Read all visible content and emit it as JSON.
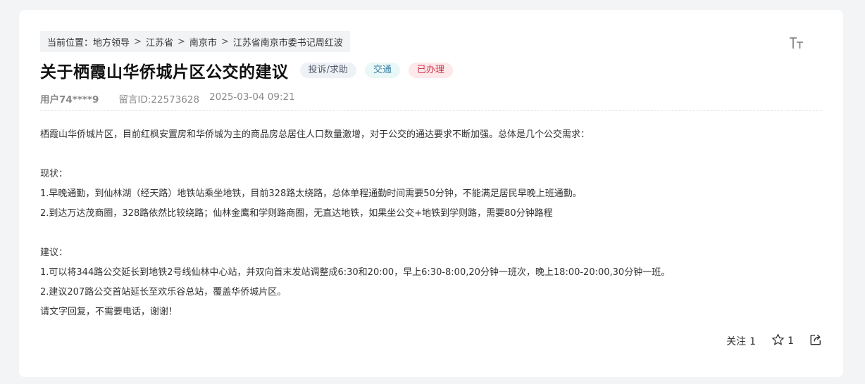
{
  "breadcrumb": {
    "prefix": "当前位置：",
    "items": [
      "地方领导",
      "江苏省",
      "南京市",
      "江苏省南京市委书记周红波"
    ],
    "separator": ">"
  },
  "post": {
    "title": "关于栖霞山华侨城片区公交的建议",
    "tags": {
      "category": "投诉/求助",
      "topic": "交通",
      "status": "已办理"
    },
    "user": "用户74****9",
    "message_id": "留言ID:22573628",
    "datetime": "2025-03-04 09:21",
    "paragraphs": [
      "栖霞山华侨城片区，目前红枫安置房和华侨城为主的商品房总居住人口数量激增，对于公交的通达要求不断加强。总体是几个公交需求：",
      "",
      "现状：",
      "1.早晚通勤，到仙林湖（经天路）地铁站乘坐地铁，目前328路太绕路，总体单程通勤时间需要50分钟，不能满足居民早晚上班通勤。",
      "2.到达万达茂商圈，328路依然比较绕路；仙林金鹰和学则路商圈，无直达地铁，如果坐公交+地铁到学则路，需要80分钟路程",
      "",
      "建议：",
      "1.可以将344路公交延长到地铁2号线仙林中心站，并双向首末发站调整成6:30和20:00，早上6:30-8:00,20分钟一班次，晚上18:00-20:00,30分钟一班。",
      "2.建议207路公交首站延长至欢乐谷总站，覆盖华侨城片区。",
      "请文字回复，不需要电话，谢谢！"
    ]
  },
  "actions": {
    "follow_label": "关注",
    "follow_count": "1",
    "star_count": "1",
    "icons": {
      "star": "star-outline-icon",
      "share": "share-icon",
      "font_size": "font-size-icon"
    }
  },
  "colors": {
    "tag_category_bg": "#eef1f6",
    "tag_topic_bg": "#e9f7f6",
    "tag_topic_text": "#3b7fa6",
    "tag_status_bg": "#fde8ea",
    "tag_status_text": "#d1374a"
  }
}
